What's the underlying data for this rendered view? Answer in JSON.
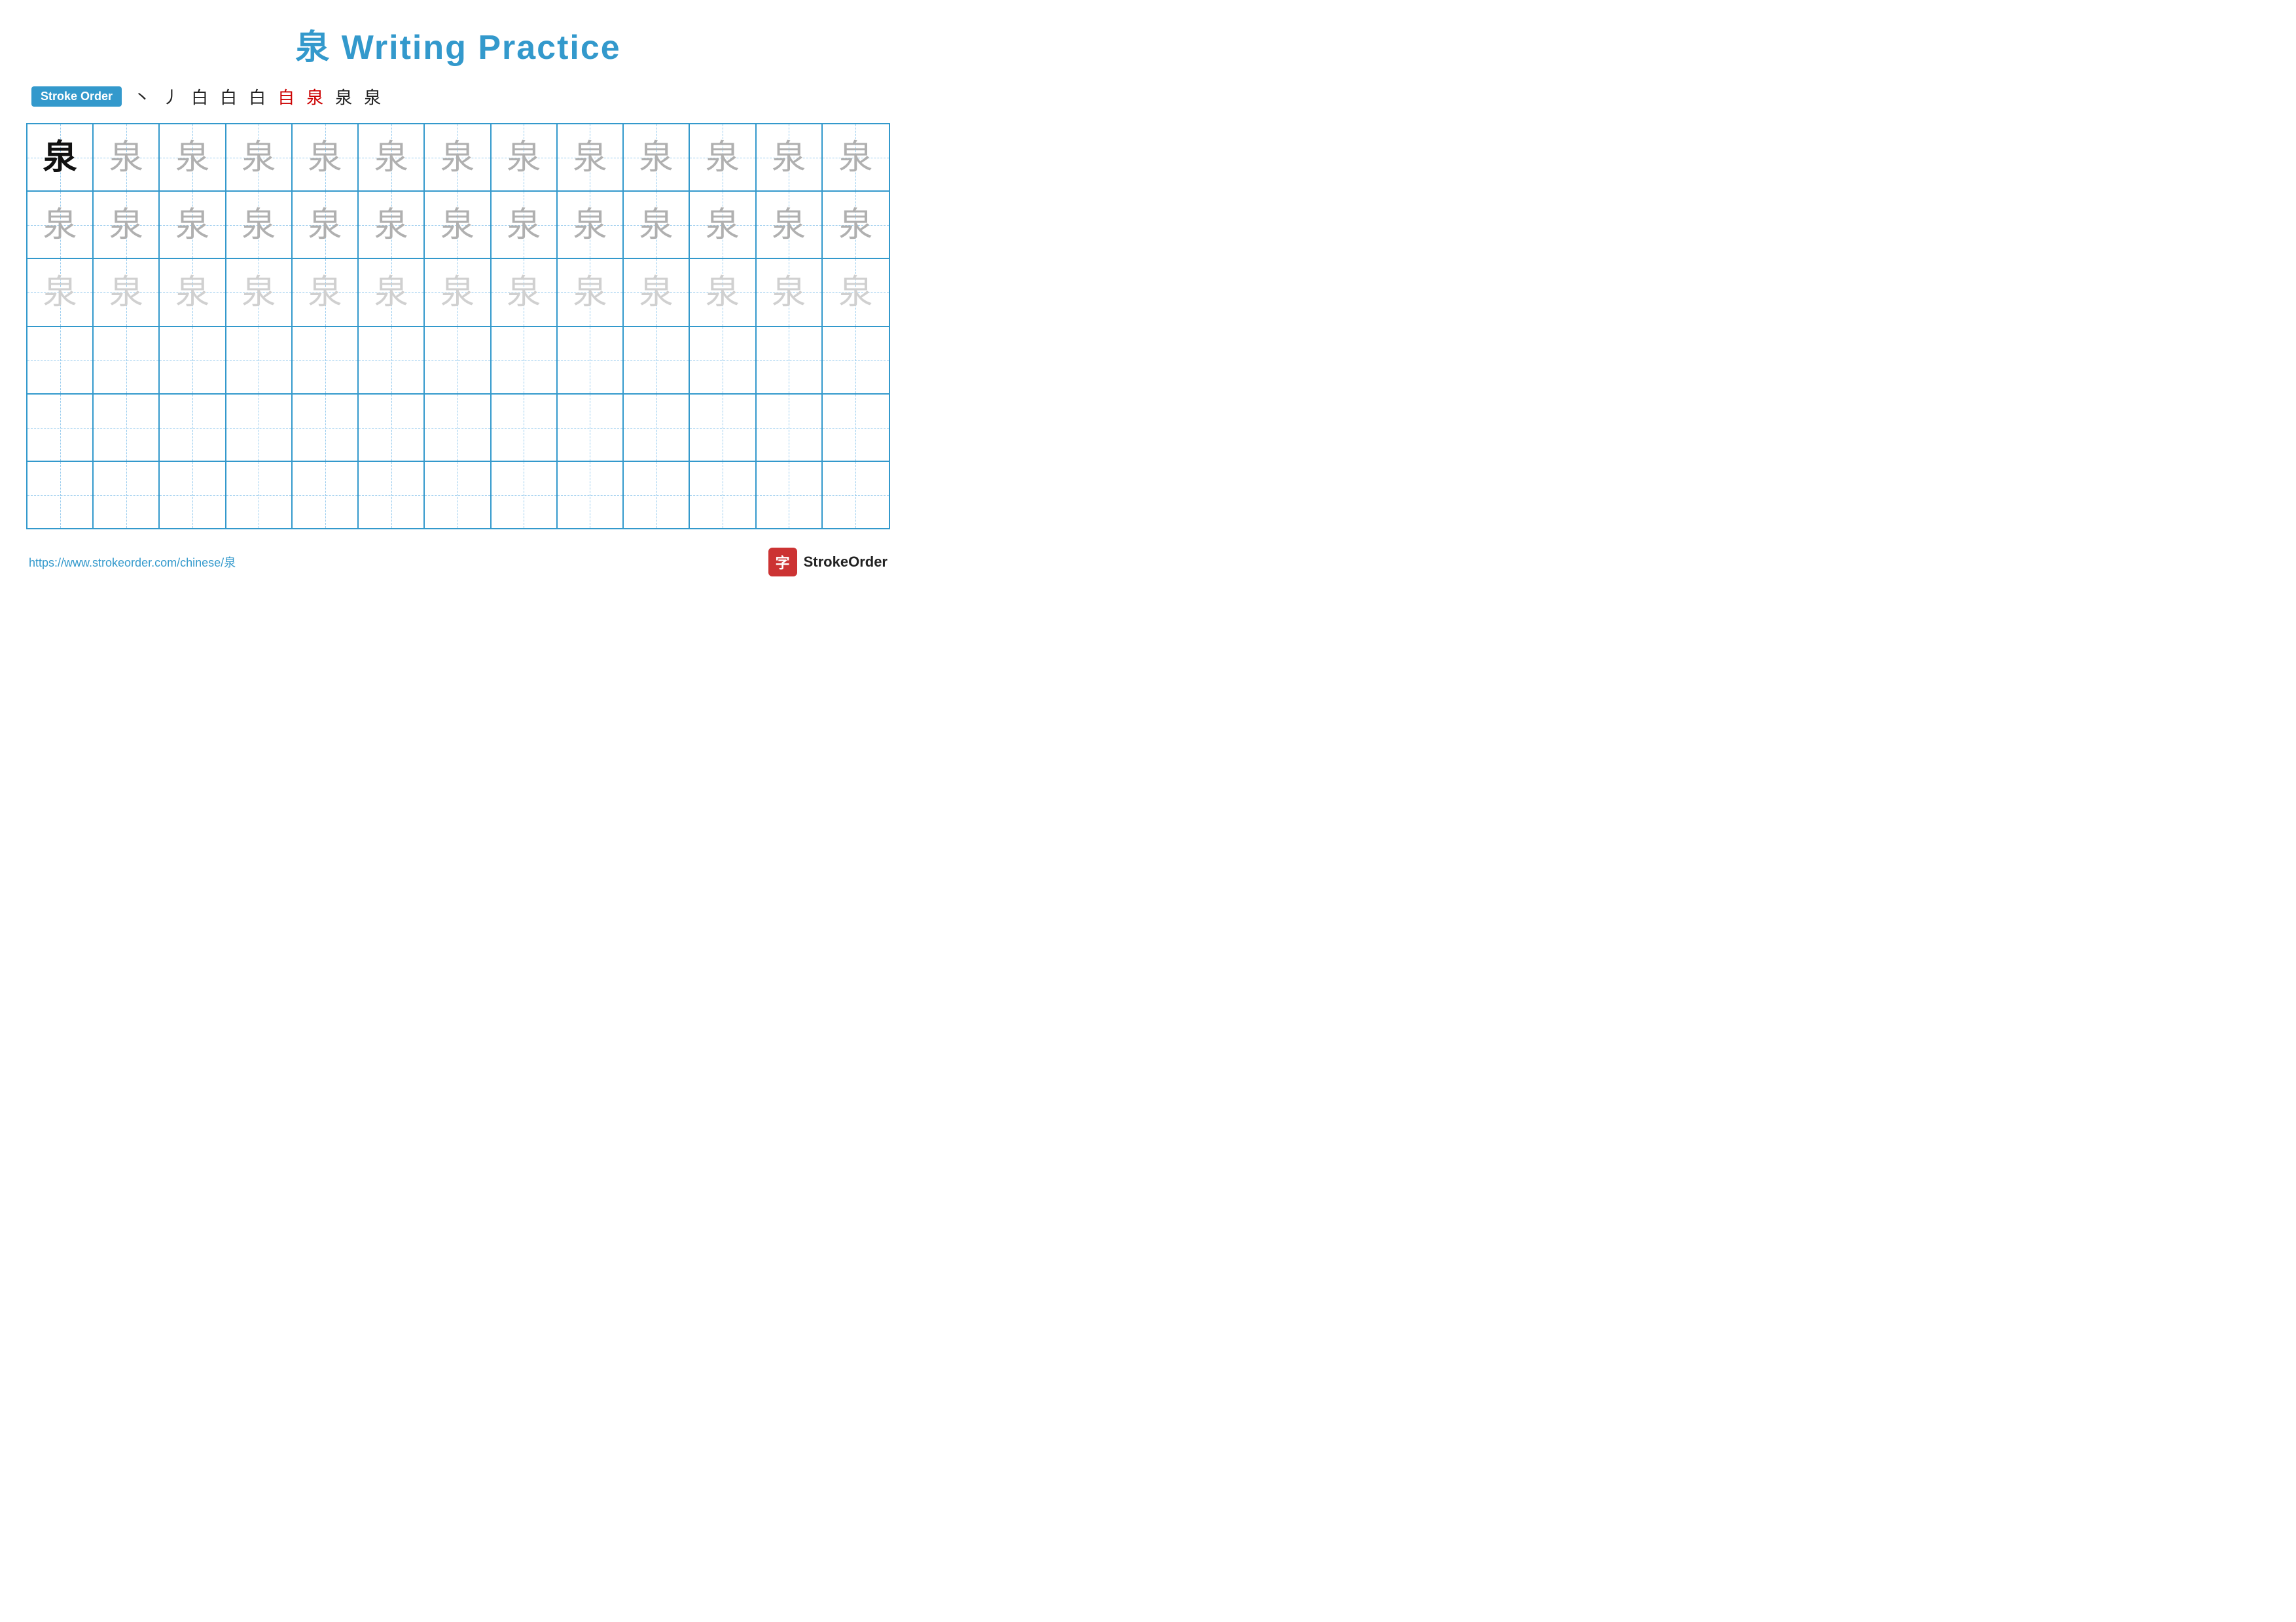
{
  "header": {
    "title": "泉 Writing Practice"
  },
  "stroke_order": {
    "badge_label": "Stroke Order",
    "steps": [
      {
        "char": "丶",
        "red": false
      },
      {
        "char": "丿",
        "red": false
      },
      {
        "char": "白",
        "red": false
      },
      {
        "char": "白",
        "red": false
      },
      {
        "char": "白",
        "red": false
      },
      {
        "char": "自",
        "red": true
      },
      {
        "char": "泉",
        "red": true
      },
      {
        "char": "泉",
        "red": false
      },
      {
        "char": "泉",
        "red": false
      }
    ]
  },
  "grid": {
    "rows": 6,
    "cols": 13,
    "character": "泉",
    "row_styles": [
      "dark",
      "medium-gray",
      "light-gray",
      "empty",
      "empty",
      "empty"
    ]
  },
  "footer": {
    "url": "https://www.strokeorder.com/chinese/泉",
    "brand_label": "StrokeOrder",
    "brand_icon": "字"
  }
}
